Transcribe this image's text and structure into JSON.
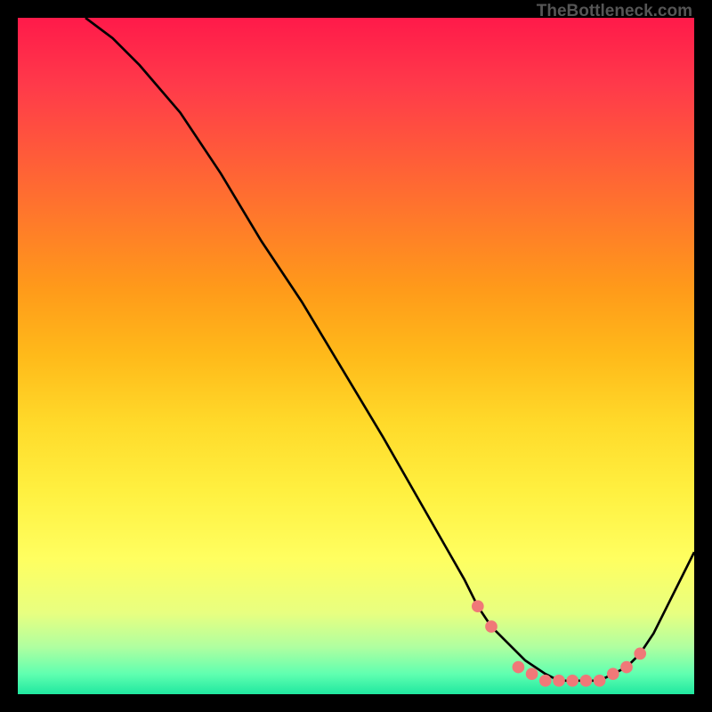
{
  "attribution": "TheBottleneck.com",
  "chart_data": {
    "type": "line",
    "title": "",
    "xlabel": "",
    "ylabel": "",
    "xlim": [
      0,
      100
    ],
    "ylim": [
      0,
      100
    ],
    "background_gradient": {
      "type": "vertical",
      "stops": [
        {
          "pos": 0,
          "color": "#ff1a4a"
        },
        {
          "pos": 10,
          "color": "#ff3a4a"
        },
        {
          "pos": 20,
          "color": "#ff5a3a"
        },
        {
          "pos": 30,
          "color": "#ff7a2a"
        },
        {
          "pos": 40,
          "color": "#ff9a1a"
        },
        {
          "pos": 50,
          "color": "#ffba1a"
        },
        {
          "pos": 60,
          "color": "#ffda2a"
        },
        {
          "pos": 70,
          "color": "#fff040"
        },
        {
          "pos": 80,
          "color": "#ffff60"
        },
        {
          "pos": 88,
          "color": "#e8ff80"
        },
        {
          "pos": 93,
          "color": "#b0ffa0"
        },
        {
          "pos": 97,
          "color": "#60ffb0"
        },
        {
          "pos": 100,
          "color": "#20e8a0"
        }
      ]
    },
    "series": [
      {
        "name": "bottleneck-curve",
        "type": "line",
        "color": "#000000",
        "x": [
          10,
          14,
          18,
          24,
          30,
          36,
          42,
          48,
          54,
          58,
          62,
          66,
          68,
          70,
          72,
          75,
          78,
          80,
          82,
          84,
          86,
          88,
          90,
          92,
          94,
          96,
          100
        ],
        "y": [
          100,
          97,
          93,
          86,
          77,
          67,
          58,
          48,
          38,
          31,
          24,
          17,
          13,
          10,
          8,
          5,
          3,
          2,
          2,
          2,
          2,
          3,
          4,
          6,
          9,
          13,
          21
        ]
      },
      {
        "name": "optimal-markers",
        "type": "scatter",
        "color": "#f07878",
        "x": [
          68,
          70,
          74,
          76,
          78,
          80,
          82,
          84,
          86,
          88,
          90,
          92
        ],
        "y": [
          13,
          10,
          4,
          3,
          2,
          2,
          2,
          2,
          2,
          3,
          4,
          6
        ]
      }
    ]
  }
}
